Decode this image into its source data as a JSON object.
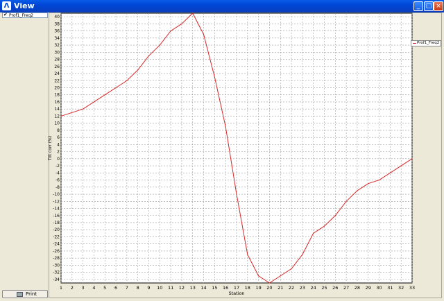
{
  "window": {
    "title": "View",
    "app_icon": "app-icon",
    "controls": [
      "minimize-icon",
      "maximize-icon",
      "close-icon"
    ]
  },
  "left_panel": {
    "layers": [
      {
        "label": "Prof1_Freq2",
        "checked": true
      }
    ],
    "print_label": "Print",
    "print_icon": "printer-icon"
  },
  "legend": {
    "items": [
      {
        "label": "Prof1_Freq2",
        "color": "#d62728"
      }
    ]
  },
  "chart_data": {
    "type": "line",
    "xlabel": "Station",
    "ylabel": "Tilt corr (%)",
    "xlim": [
      1,
      33
    ],
    "ylim": [
      -35,
      41
    ],
    "x_ticks": [
      1,
      2,
      3,
      4,
      5,
      6,
      7,
      8,
      9,
      10,
      11,
      12,
      13,
      14,
      15,
      16,
      17,
      18,
      19,
      20,
      21,
      22,
      23,
      24,
      25,
      26,
      27,
      28,
      29,
      30,
      31,
      32,
      33
    ],
    "y_ticks": [
      40,
      38,
      36,
      34,
      32,
      30,
      28,
      26,
      24,
      22,
      20,
      18,
      16,
      14,
      12,
      10,
      8,
      6,
      4,
      2,
      0,
      -2,
      -4,
      -6,
      -8,
      -10,
      -12,
      -14,
      -16,
      -18,
      -20,
      -22,
      -24,
      -26,
      -28,
      -30,
      -32,
      -34
    ],
    "grid": true,
    "legend_position": "right",
    "series": [
      {
        "name": "Prof1_Freq2",
        "color": "#d62728",
        "x": [
          1,
          2,
          3,
          4,
          5,
          6,
          7,
          8,
          9,
          10,
          11,
          12,
          13,
          14,
          15,
          16,
          17,
          18,
          19,
          20,
          21,
          22,
          23,
          24,
          25,
          26,
          27,
          28,
          29,
          30,
          31,
          32,
          33
        ],
        "y": [
          12,
          13,
          14,
          16,
          18,
          20,
          22,
          25,
          29,
          32,
          36,
          38,
          41,
          35,
          23,
          9,
          -10,
          -27,
          -33,
          -35,
          -33,
          -31,
          -27,
          -21,
          -19,
          -16,
          -12,
          -9,
          -7,
          -6,
          -4,
          -2,
          0
        ]
      }
    ]
  }
}
